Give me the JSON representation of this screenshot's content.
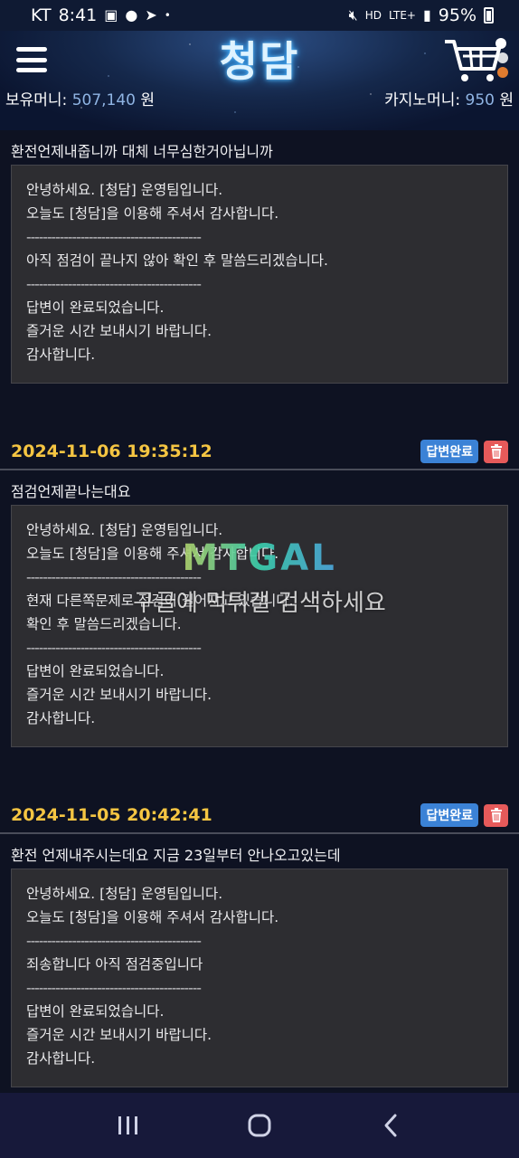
{
  "status_bar": {
    "carrier": "KT",
    "time": "8:41",
    "network": "LTE+",
    "battery": "95%"
  },
  "header": {
    "logo": "청담",
    "balance_label": "보유머니:",
    "balance_value": "507,140",
    "balance_unit": "원",
    "casino_label": "카지노머니:",
    "casino_value": "950",
    "casino_unit": "원"
  },
  "posts": [
    {
      "title": "환전언제내줍니까 대체 너무심한거아닙니까",
      "answer": {
        "greeting1": "안녕하세요. [청담] 운영팀입니다.",
        "greeting2": "오늘도 [청담]을 이용해 주셔서 감사합니다.",
        "separator1": "------------------------------------------",
        "body1": "아직 점검이 끝나지 않아 확인 후 말씀드리겠습니다.",
        "body2": "",
        "separator2": "------------------------------------------",
        "closing1": "답변이 완료되었습니다.",
        "closing2": "즐거운 시간 보내시기 바랍니다.",
        "closing3": "감사합니다."
      }
    },
    {
      "date": "2024-11-06 19:35:12",
      "status": "답변완료",
      "title": "점검언제끝나는대요",
      "answer": {
        "greeting1": "안녕하세요. [청담] 운영팀입니다.",
        "greeting2": "오늘도 [청담]을 이용해 주셔서 감사합니다.",
        "separator1": "------------------------------------------",
        "body1": "현재 다른쪽문제로 점검이 길어지고 있습니다.",
        "body2": "확인 후 말씀드리겠습니다.",
        "separator2": "------------------------------------------",
        "closing1": "답변이 완료되었습니다.",
        "closing2": "즐거운 시간 보내시기 바랍니다.",
        "closing3": "감사합니다."
      }
    },
    {
      "date": "2024-11-05 20:42:41",
      "status": "답변완료",
      "title": "환전 언제내주시는데요 지금 23일부터 안나오고있는데",
      "answer": {
        "greeting1": "안녕하세요. [청담] 운영팀입니다.",
        "greeting2": "오늘도 [청담]을 이용해 주셔서 감사합니다.",
        "separator1": "------------------------------------------",
        "body1": "죄송합니다 아직 점검중입니다",
        "body2": "",
        "separator2": "------------------------------------------",
        "closing1": "답변이 완료되었습니다.",
        "closing2": "즐거운 시간 보내시기 바랍니다.",
        "closing3": "감사합니다."
      }
    }
  ],
  "watermark": {
    "logo": "MTGAL",
    "text": "구글에 먹튀갤 검색하세요"
  },
  "colors": {
    "date": "#f5c542",
    "badge": "#3b82d6",
    "delete": "#e65a5a",
    "answer_bg": "#2d2d31",
    "page_bg": "#0e1222"
  }
}
